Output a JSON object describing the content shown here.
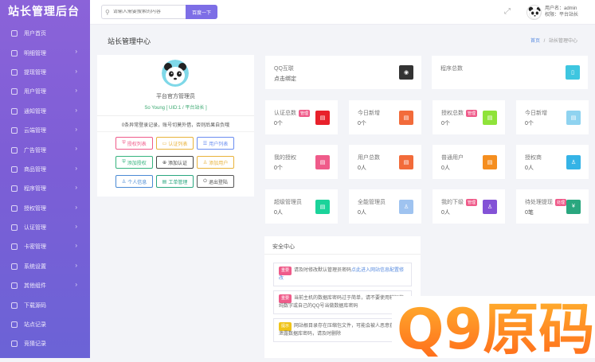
{
  "brand": "站长管理后台",
  "nav": [
    {
      "label": "用户首页",
      "chev": false
    },
    {
      "label": "明细管理",
      "chev": true
    },
    {
      "label": "提现管理",
      "chev": true
    },
    {
      "label": "用户管理",
      "chev": true
    },
    {
      "label": "通知管理",
      "chev": true
    },
    {
      "label": "云端管理",
      "chev": true
    },
    {
      "label": "广告管理",
      "chev": true
    },
    {
      "label": "商品管理",
      "chev": true
    },
    {
      "label": "程序管理",
      "chev": true
    },
    {
      "label": "授权管理",
      "chev": true
    },
    {
      "label": "认证管理",
      "chev": true
    },
    {
      "label": "卡密管理",
      "chev": true
    },
    {
      "label": "系统设置",
      "chev": true
    },
    {
      "label": "其他组件",
      "chev": true
    },
    {
      "label": "下载源码",
      "chev": false
    },
    {
      "label": "站点记录",
      "chev": false
    },
    {
      "label": "竞猜记录",
      "chev": false
    }
  ],
  "search": {
    "placeholder": "请输入需要搜索的内容",
    "button": "百度一下"
  },
  "user": {
    "name": "用户名：admin",
    "role": "权限：平台站长"
  },
  "page": {
    "title": "站长管理中心",
    "crumb_home": "首页",
    "crumb_sep": "/",
    "crumb_current": "站长管理中心"
  },
  "profile": {
    "name": "平台官方管理员",
    "uid": "So Young [ UID:1 / 平台站长 ]",
    "note": "0条异常登录记录，账号切莫外借，否则后果自负哦",
    "buttons": [
      {
        "label": "授权列表",
        "color": "#ef5b8a",
        "icon": "shield"
      },
      {
        "label": "认证列表",
        "color": "#e8b23a",
        "icon": "id-card"
      },
      {
        "label": "用户列表",
        "color": "#6a8df0",
        "icon": "list"
      },
      {
        "label": "添加授权",
        "color": "#36b37e",
        "icon": "shield-plus"
      },
      {
        "label": "添加认证",
        "color": "#444444",
        "icon": "plus-circle"
      },
      {
        "label": "添加用户",
        "color": "#e8b23a",
        "icon": "user-plus"
      },
      {
        "label": "个人信息",
        "color": "#4a8ad4",
        "icon": "user"
      },
      {
        "label": "工单管理",
        "color": "#2aa77f",
        "icon": "ticket"
      },
      {
        "label": "退出登陆",
        "color": "#555555",
        "icon": "power"
      }
    ]
  },
  "cards": [
    {
      "label": "QQ互联",
      "value": "点击绑定",
      "color": "#333333",
      "tag": "",
      "icon": "qq"
    },
    {
      "label": "程序总数",
      "value": "",
      "color": "#3ec6e0",
      "tag": "",
      "icon": "phone"
    },
    {
      "label": "认证总数",
      "value": "0个",
      "color": "#e8212b",
      "tag": "管理",
      "icon": "doc"
    },
    {
      "label": "今日新增",
      "value": "0个",
      "color": "#f26b3a",
      "tag": "",
      "icon": "doc"
    },
    {
      "label": "授权总数",
      "value": "0个",
      "color": "#8fe33a",
      "tag": "管理",
      "icon": "doc"
    },
    {
      "label": "今日新增",
      "value": "0个",
      "color": "#8fd3f0",
      "tag": "",
      "icon": "doc"
    },
    {
      "label": "我的授权",
      "value": "0个",
      "color": "#ef5b8a",
      "tag": "",
      "icon": "doc"
    },
    {
      "label": "用户总数",
      "value": "0人",
      "color": "#f26b3a",
      "tag": "",
      "icon": "doc"
    },
    {
      "label": "普通用户",
      "value": "0人",
      "color": "#f58e1f",
      "tag": "",
      "icon": "doc"
    },
    {
      "label": "授权商",
      "value": "0人",
      "color": "#35b3e6",
      "tag": "",
      "icon": "user"
    },
    {
      "label": "超级管理员",
      "value": "0人",
      "color": "#1bd39a",
      "tag": "",
      "icon": "doc"
    },
    {
      "label": "全能管理员",
      "value": "0人",
      "color": "#9fc3f0",
      "tag": "",
      "icon": "user"
    },
    {
      "label": "我的下级",
      "value": "0人",
      "color": "#8352d6",
      "tag": "管理",
      "icon": "user"
    },
    {
      "label": "待处理提现",
      "value": "0笔",
      "color": "#2aa77f",
      "tag": "处理",
      "icon": "yen"
    }
  ],
  "security": {
    "title": "安全中心",
    "notices": [
      {
        "badge": "重要",
        "badge_color": "#ef5b8a",
        "text": "请及时修改默认管理员密码",
        "link": "点此进入网站信息配置修改"
      },
      {
        "badge": "重要",
        "badge_color": "#ef5b8a",
        "text": "当前主机的数据库密码过于简单，请不要使用较短的纯数字或自己的QQ号当做数据库密码",
        "link": ""
      },
      {
        "badge": "提示",
        "badge_color": "#f0c419",
        "text": "网站根目录存在压缩包文件，可能会被人恶意获取并泄露数据库密码，请及时删除",
        "link": ""
      }
    ]
  },
  "watermark": "Q9原码",
  "colors": {
    "primary": "#7d6ee6",
    "sidebar_top": "#8b63d9",
    "sidebar_bottom": "#6b63d6"
  }
}
